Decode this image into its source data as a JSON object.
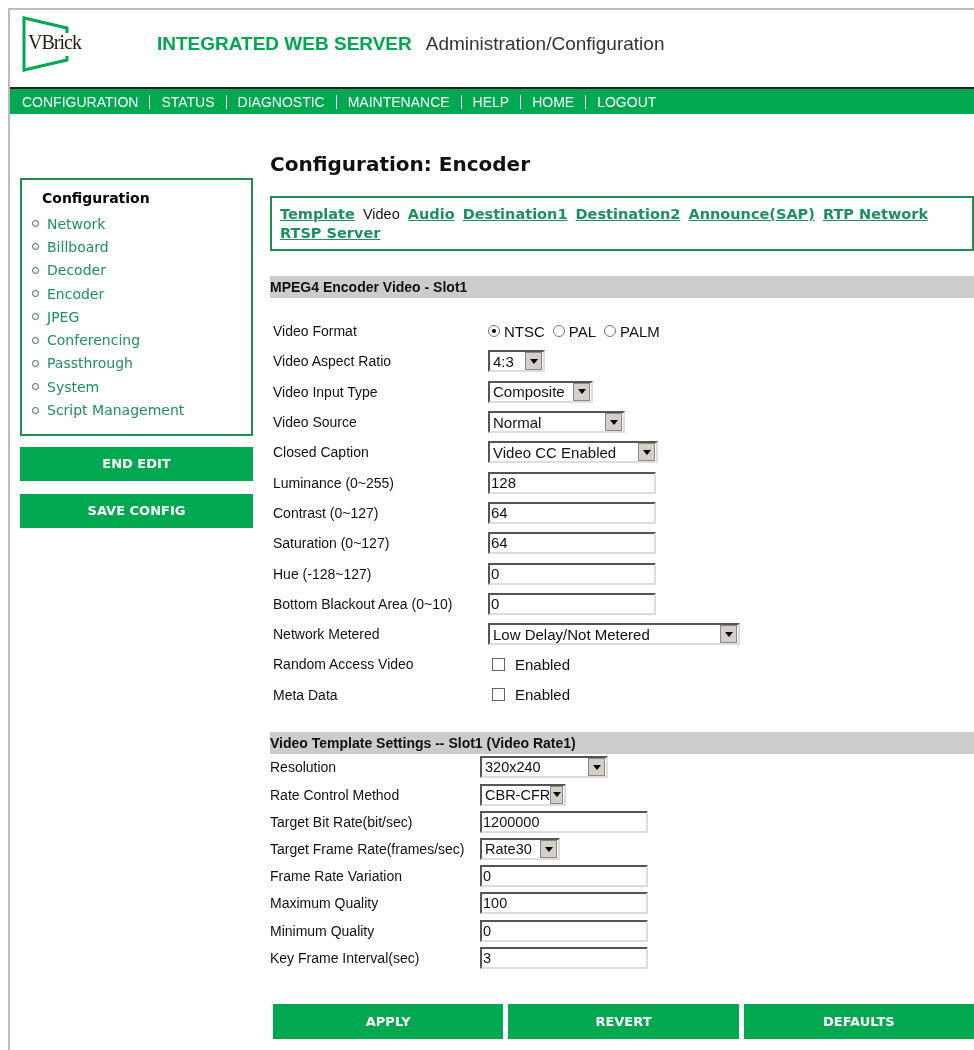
{
  "header": {
    "logo": "VBrick",
    "product": "INTEGRATED WEB SERVER",
    "subtitle": "Administration/Configuration"
  },
  "nav": [
    "CONFIGURATION",
    "STATUS",
    "DIAGNOSTIC",
    "MAINTENANCE",
    "HELP",
    "HOME",
    "LOGOUT"
  ],
  "sidebar": {
    "title": "Configuration",
    "items": [
      "Network",
      "Billboard",
      "Decoder",
      "Encoder",
      "JPEG",
      "Conferencing",
      "Passthrough",
      "System",
      "Script Management"
    ],
    "buttons": [
      "END EDIT",
      "SAVE CONFIG"
    ]
  },
  "page_title": "Configuration: Encoder",
  "tabs": [
    {
      "label": "Template",
      "selected": false
    },
    {
      "label": "Video",
      "selected": true
    },
    {
      "label": "Audio",
      "selected": false
    },
    {
      "label": "Destination1",
      "selected": false
    },
    {
      "label": "Destination2",
      "selected": false
    },
    {
      "label": "Announce(SAP)",
      "selected": false
    },
    {
      "label": "RTP Network",
      "selected": false
    },
    {
      "label": "RTSP Server",
      "selected": false
    }
  ],
  "sections": [
    {
      "title": "MPEG4 Encoder Video - Slot1",
      "fields": [
        {
          "kind": "radio",
          "label": "Video Format",
          "options": [
            {
              "label": "NTSC",
              "selected": true
            },
            {
              "label": "PAL",
              "selected": false
            },
            {
              "label": "PALM",
              "selected": false
            }
          ]
        },
        {
          "kind": "select",
          "label": "Video Aspect Ratio",
          "value": "4:3"
        },
        {
          "kind": "select",
          "label": "Video Input Type",
          "value": "Composite"
        },
        {
          "kind": "select",
          "label": "Video Source",
          "value": "Normal"
        },
        {
          "kind": "select",
          "label": "Closed Caption",
          "value": "Video CC Enabled"
        },
        {
          "kind": "text",
          "label": "Luminance (0~255)",
          "value": "128"
        },
        {
          "kind": "text",
          "label": "Contrast (0~127)",
          "value": "64"
        },
        {
          "kind": "text",
          "label": "Saturation (0~127)",
          "value": "64"
        },
        {
          "kind": "text",
          "label": "Hue (-128~127)",
          "value": "0"
        },
        {
          "kind": "text",
          "label": "Bottom Blackout Area (0~10)",
          "value": "0"
        },
        {
          "kind": "select",
          "label": "Network Metered",
          "value": "Low Delay/Not Metered"
        },
        {
          "kind": "checkbox",
          "label": "Random Access Video",
          "option": "Enabled",
          "checked": false
        },
        {
          "kind": "checkbox",
          "label": "Meta Data",
          "option": "Enabled",
          "checked": false
        }
      ]
    },
    {
      "title": "Video Template Settings -- Slot1 (Video Rate1)",
      "fields": [
        {
          "kind": "select",
          "label": "Resolution",
          "value": "320x240"
        },
        {
          "kind": "select",
          "label": "Rate Control Method",
          "value": "CBR-CFR"
        },
        {
          "kind": "text",
          "label": "Target Bit Rate(bit/sec)",
          "value": "1200000"
        },
        {
          "kind": "select",
          "label": "Target Frame Rate(frames/sec)",
          "value": "Rate30"
        },
        {
          "kind": "text",
          "label": "Frame Rate Variation",
          "value": "0"
        },
        {
          "kind": "text",
          "label": "Maximum Quality",
          "value": "100"
        },
        {
          "kind": "text",
          "label": "Minimum Quality",
          "value": "0"
        },
        {
          "kind": "text",
          "label": "Key Frame Interval(sec)",
          "value": "3"
        }
      ]
    }
  ],
  "actions": [
    "APPLY",
    "REVERT",
    "DEFAULTS"
  ]
}
